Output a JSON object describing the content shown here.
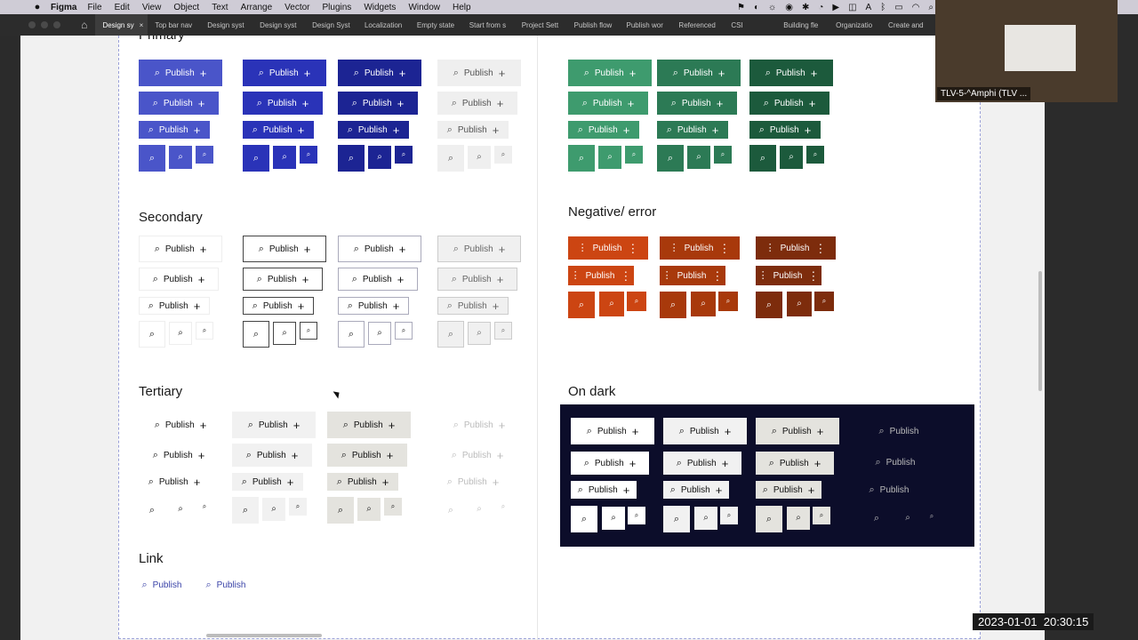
{
  "menubar": {
    "app_name": "Figma",
    "items": [
      "File",
      "Edit",
      "View",
      "Object",
      "Text",
      "Arrange",
      "Vector",
      "Plugins",
      "Widgets",
      "Window",
      "Help"
    ]
  },
  "tabs": [
    {
      "label": "Design sy",
      "active": true
    },
    {
      "label": "Top bar nav"
    },
    {
      "label": "Design syst"
    },
    {
      "label": "Design syst"
    },
    {
      "label": "Design Syst"
    },
    {
      "label": "Localization"
    },
    {
      "label": "Empty state"
    },
    {
      "label": "Start from s"
    },
    {
      "label": "Project Sett"
    },
    {
      "label": "Publish flow"
    },
    {
      "label": "Publish wor"
    },
    {
      "label": "Referenced"
    },
    {
      "label": "CSI"
    },
    {
      "label": "Building fle"
    },
    {
      "label": "Organizatio"
    },
    {
      "label": "Create and "
    }
  ],
  "sections": {
    "primary": "Primary",
    "secondary": "Secondary",
    "tertiary": "Tertiary",
    "link": "Link",
    "negative": "Negative/ error",
    "on_dark": "On dark"
  },
  "button_label": "Publish",
  "colors": {
    "primary": [
      "#4a55c9",
      "#2a33b8",
      "#1c2493",
      "#efefef"
    ],
    "success": [
      "#3e9b6e",
      "#2c7a55",
      "#1c5a3c"
    ],
    "negative": [
      "#cc4512",
      "#a8390b",
      "#7d2c0c"
    ],
    "dark_bg": "#0c0d2a",
    "link": "#3a43a8"
  },
  "webcam_label": "TLV-5-^Amphi (TLV ...",
  "clock": {
    "date": "2023-01-01",
    "time": "20:30:15"
  }
}
